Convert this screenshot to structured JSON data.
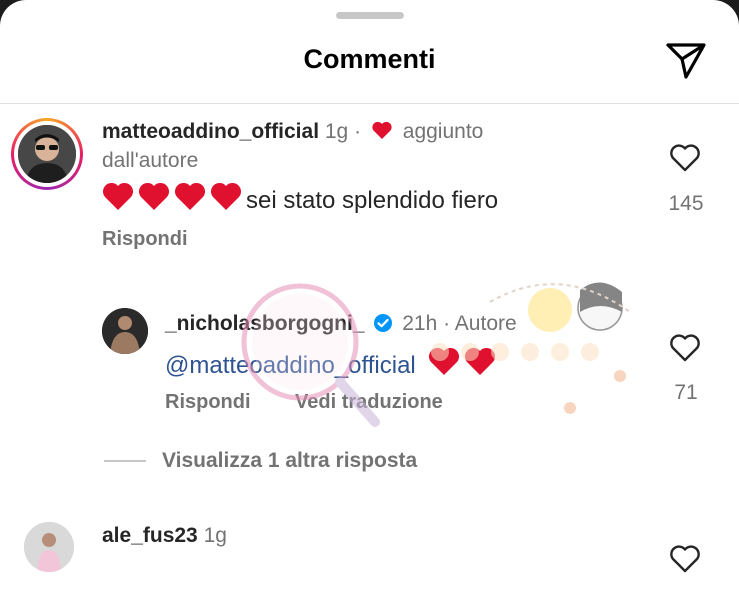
{
  "header": {
    "title": "Commenti",
    "share_icon": "send-icon"
  },
  "comments": [
    {
      "username": "matteoaddino_official",
      "time": "1g",
      "separator": "·",
      "badge_prefix": "aggiunto",
      "badge_suffix": "dall'autore",
      "text": "sei stato splendido fiero",
      "emoji": [
        "heart",
        "heart",
        "heart",
        "heart"
      ],
      "reply_label": "Rispondi",
      "like_count": "145"
    },
    {
      "username": "_nicholasborgogni_",
      "verified": true,
      "time": "21h",
      "separator": "·",
      "author_label": "Autore",
      "mention": "@matteoaddino_official",
      "emoji": [
        "heart",
        "heart"
      ],
      "reply_label": "Rispondi",
      "translate_label": "Vedi traduzione",
      "like_count": "71"
    },
    {
      "username": "ale_fus23",
      "time": "1g"
    }
  ],
  "view_more_replies": "Visualizza 1 altra risposta",
  "colors": {
    "accent_heart": "#e0102f",
    "muted": "#737373",
    "verified": "#0095f6"
  }
}
